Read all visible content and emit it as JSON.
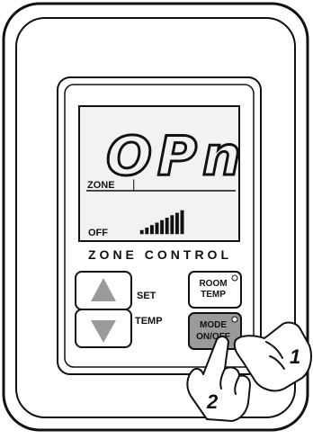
{
  "lcd": {
    "main_readout": "OPn",
    "zone_label": "ZONE",
    "zone_cursor": "|",
    "status": "OFF",
    "signal_level": 9,
    "signal_max": 9
  },
  "panel_title": "ZONE CONTROL",
  "buttons": {
    "set_label": "SET",
    "temp_label": "TEMP",
    "room_temp_line1": "ROOM",
    "room_temp_line2": "TEMP",
    "mode_line1": "MODE",
    "mode_line2": "ON/OFF"
  },
  "callouts": {
    "step_1": "1",
    "step_2": "2"
  },
  "colors": {
    "lcd_background": "#f2f2f2",
    "mode_button": "#9a9a9a",
    "arrow": "#9a9a9a",
    "outline": "#111111"
  }
}
